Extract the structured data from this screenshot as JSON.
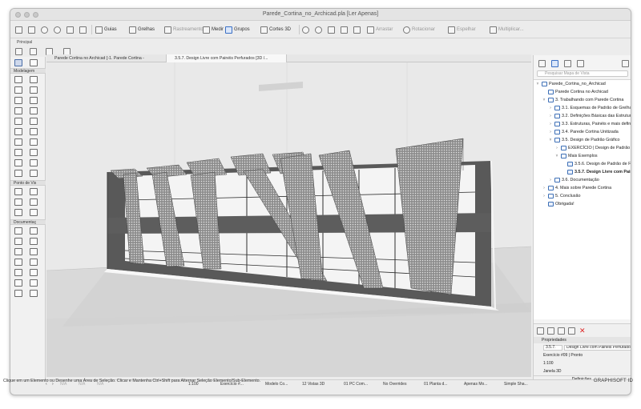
{
  "window": {
    "title": "Parede_Cortina_no_Archicad.pla [Ler Apenas]"
  },
  "toolbar": {
    "guias": "Guias",
    "grelhas": "Grelhas",
    "rastreamento": "Rastreamento",
    "medir": "Medir",
    "grupos": "Grupos",
    "cortes3d": "Cortes 3D",
    "arrastar": "Arrastar",
    "rotacionar": "Rotacionar",
    "espelhar": "Espelhar",
    "multiplicar": "Multiplicar..."
  },
  "principal_label": "Principal",
  "toolbox": {
    "section_modelagem": "Modelagem",
    "section_ponto": "Ponto de Vis",
    "section_documentacao": "Documentaç"
  },
  "tabs": [
    {
      "label": "Parede Cortina no Archicad [-1. Parede Cortina -"
    },
    {
      "label": "3.5.7. Design Livre com Painéis Perfurados [3D /..."
    }
  ],
  "navigator": {
    "search_placeholder": "Pesquisar Mapa de Vista",
    "items": [
      {
        "label": "Parede_Cortina_no_Archicad"
      },
      {
        "label": "Parede Cortina no Archicad"
      },
      {
        "label": "3. Trabalhando com Parede Cortina"
      },
      {
        "label": "3.1. Esquemas de Padrão de Grelha"
      },
      {
        "label": "3.2. Definições Básicas das Estruturas"
      },
      {
        "label": "3.3. Estruturas, Painéis e mais definiçõ"
      },
      {
        "label": "3.4. Parede Cortina Unitizada"
      },
      {
        "label": "3.5. Design de Padrão Gráfico"
      },
      {
        "label": "EXERCÍCIO | Design de Padrão Gráfic"
      },
      {
        "label": "Mais Exemplos"
      },
      {
        "label": "3.5.6. Design de Padrão de Folha"
      },
      {
        "label": "3.5.7. Design Livre com Painéis"
      },
      {
        "label": "3.6. Documentação"
      },
      {
        "label": "4. Mais sobre Parede Cortina"
      },
      {
        "label": "5. Conclusão"
      },
      {
        "label": "Obrigada!"
      }
    ]
  },
  "properties": {
    "header": "Propriedades",
    "id": "3.5.7.",
    "name": "Design Livre com Painéis Perfurado",
    "layer_combo": "Exercício #09 | Pronto",
    "scale": "1:100",
    "window_label": "Janela 3D",
    "settings_button": "Definições..."
  },
  "statusbar": {
    "zoom_a": "N/A",
    "zoom_b": "N/A",
    "zoom_c": "N/A",
    "scale": "1:100",
    "layer": "Exercício #...",
    "model": "Modelo Co...",
    "views": "12 Vistas 3D",
    "pen": "01 PC Com...",
    "overrides": "No Overrides",
    "plan": "01 Planta d...",
    "mode": "Apenas Mo...",
    "shading": "Simple Sha..."
  },
  "hint": "Clique em um Elemento ou Desenhe uma Área de Seleção. Clicar e Mantenha Ctrl+Shift para Alternar Seleção Elemento/Sub-Elemento.",
  "brand": "GRAPHISOFT ID"
}
